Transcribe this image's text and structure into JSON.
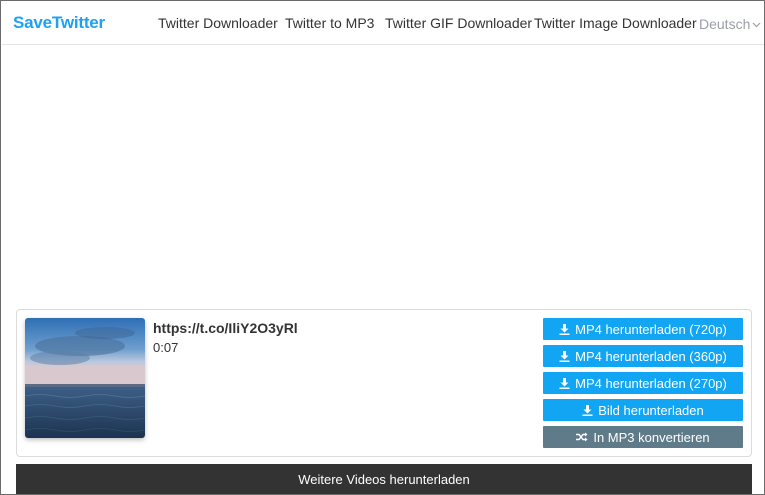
{
  "nav": {
    "brand": "SaveTwitter",
    "links": [
      "Twitter Downloader",
      "Twitter to MP3",
      "Twitter GIF Downloader",
      "Twitter Image Downloader"
    ],
    "language": "Deutsch"
  },
  "result": {
    "title": "https://t.co/IliY2O3yRl",
    "duration": "0:07",
    "buttons": {
      "mp4_720": "MP4 herunterladen (720p)",
      "mp4_360": "MP4 herunterladen (360p)",
      "mp4_270": "MP4 herunterladen (270p)",
      "image": "Bild herunterladen",
      "mp3": "In MP3 konvertieren"
    }
  },
  "more_videos": "Weitere Videos herunterladen",
  "colors": {
    "brand": "#1da1f2",
    "primary_button": "#12a5f4",
    "secondary_button": "#5f7b8a",
    "bottom_bar": "#333333"
  },
  "icons": {
    "download": "download-icon",
    "shuffle": "shuffle-icon",
    "chevron": "chevron-down-icon"
  }
}
